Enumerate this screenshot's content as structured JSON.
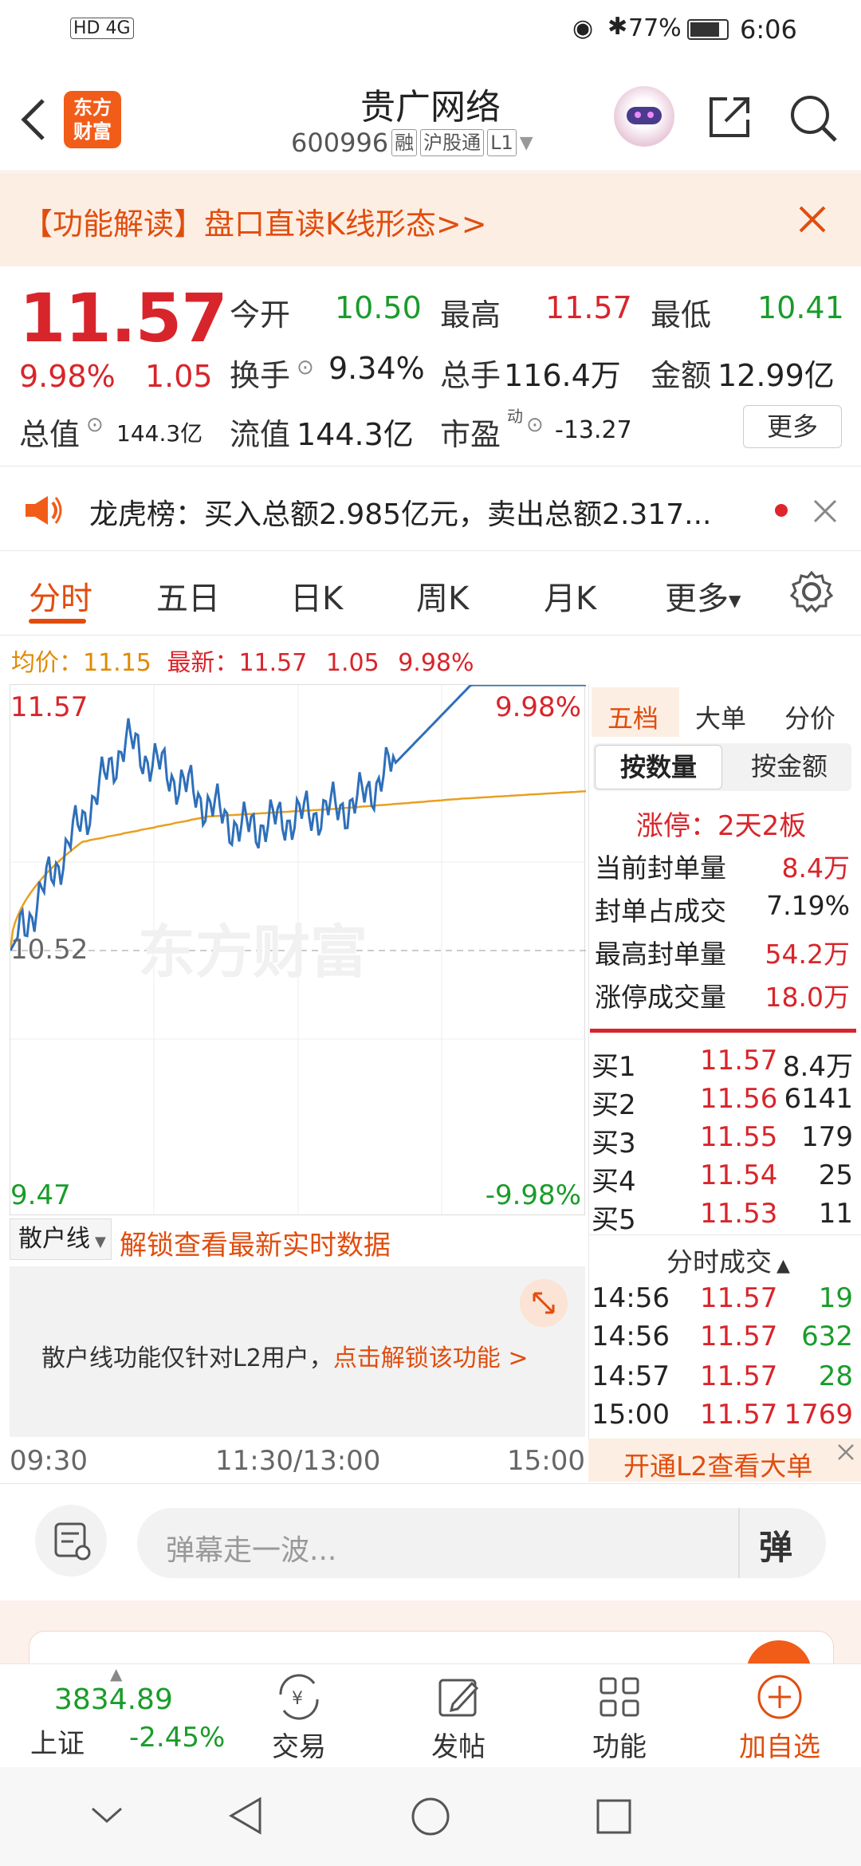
{
  "status_bar": {
    "signal": "HD 4G",
    "battery": "77%",
    "time": "6:06"
  },
  "header": {
    "logo_line1": "东方",
    "logo_line2": "财富",
    "title": "贵广网络",
    "code": "600996",
    "tags": [
      "融",
      "沪股通",
      "L1"
    ]
  },
  "banner": {
    "text": "【功能解读】盘口直读K线形态>>"
  },
  "quote": {
    "price": "11.57",
    "change_pct": "9.98%",
    "change": "1.05",
    "open_label": "今开",
    "open": "10.50",
    "high_label": "最高",
    "high": "11.57",
    "low_label": "最低",
    "low": "10.41",
    "turnover_label": "换手",
    "turnover": "9.34%",
    "volume_label": "总手",
    "volume": "116.4万",
    "amount_label": "金额",
    "amount": "12.99亿",
    "mktcap_label": "总值",
    "mktcap": "144.3亿",
    "float_label": "流值",
    "float": "144.3亿",
    "pe_label": "市盈",
    "pe_sup": "动",
    "pe": "-13.27",
    "more": "更多"
  },
  "notice": {
    "text": "龙虎榜：买入总额2.985亿元，卖出总额2.317..."
  },
  "tabs": [
    "分时",
    "五日",
    "日K",
    "周K",
    "月K",
    "更多"
  ],
  "legend": {
    "avg_label": "均价：",
    "avg": "11.15",
    "last_label": "最新：",
    "last": "11.57",
    "chg": "1.05",
    "pct": "9.98%"
  },
  "chart": {
    "y_high": "11.57",
    "y_high_pct": "9.98%",
    "y_mid": "10.52",
    "y_low": "9.47",
    "y_low_pct": "-9.98%",
    "x_labels": [
      "09:30",
      "11:30/13:00",
      "15:00"
    ],
    "watermark": "东方财富"
  },
  "chart_data": {
    "type": "line",
    "x": [
      "09:30",
      "11:30/13:00",
      "15:00"
    ],
    "series": [
      {
        "values": [
          10.52,
          11.35,
          11.0,
          11.1,
          11.57,
          11.57
        ]
      },
      {
        "values": [
          10.52,
          10.95,
          11.05,
          11.08,
          11.12,
          11.15
        ]
      }
    ],
    "ylim": [
      9.47,
      11.57
    ]
  },
  "retail": {
    "selector": "散户线",
    "unlock": "解锁查看最新实时数据",
    "note": "散户线功能仅针对L2用户，",
    "note_link": "点击解锁该功能 >"
  },
  "right_panel": {
    "tabs": [
      "五档",
      "大单",
      "分价"
    ],
    "subtabs": [
      "按数量",
      "按金额"
    ],
    "limit_up": "涨停：2天2板",
    "stats": [
      {
        "label": "当前封单量",
        "value": "8.4万"
      },
      {
        "label": "封单占成交",
        "value": "7.19%"
      },
      {
        "label": "最高封单量",
        "value": "54.2万"
      },
      {
        "label": "涨停成交量",
        "value": "18.0万"
      }
    ],
    "bids": [
      {
        "label": "买1",
        "price": "11.57",
        "vol": "8.4万"
      },
      {
        "label": "买2",
        "price": "11.56",
        "vol": "6141"
      },
      {
        "label": "买3",
        "price": "11.55",
        "vol": "179"
      },
      {
        "label": "买4",
        "price": "11.54",
        "vol": "25"
      },
      {
        "label": "买5",
        "price": "11.53",
        "vol": "11"
      }
    ],
    "ticks_title": "分时成交",
    "ticks": [
      {
        "time": "14:56",
        "price": "11.57",
        "vol": "19"
      },
      {
        "time": "14:56",
        "price": "11.57",
        "vol": "632"
      },
      {
        "time": "14:57",
        "price": "11.57",
        "vol": "28"
      },
      {
        "time": "15:00",
        "price": "11.57",
        "vol": "1769"
      }
    ],
    "l2_promo": "开通L2查看大单"
  },
  "comment": {
    "placeholder": "弹幕走一波...",
    "danmu": "弹"
  },
  "bottom_nav": {
    "index_value": "3834.89",
    "index_name": "上证",
    "index_change": "-2.45%",
    "items": [
      "交易",
      "发帖",
      "功能",
      "加自选"
    ]
  }
}
